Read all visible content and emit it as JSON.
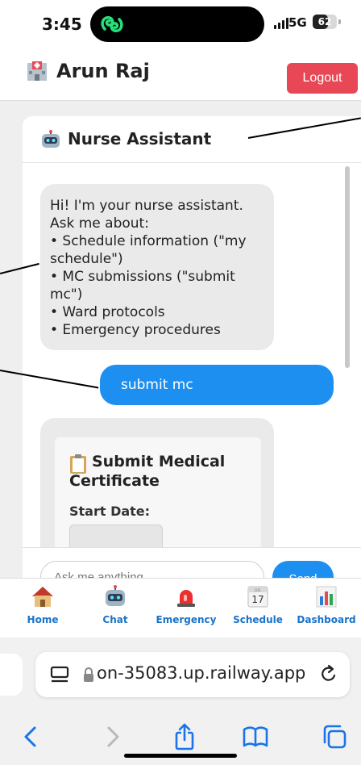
{
  "status_bar": {
    "time": "3:45",
    "network": "5G",
    "battery": "62",
    "battery_level": 0.62
  },
  "header": {
    "username": "Arun Raj",
    "logout_label": "Logout"
  },
  "chat": {
    "title": "Nurse Assistant",
    "bot_message": [
      "Hi! I'm your nurse assistant.",
      "Ask me about:",
      "• Schedule information (\"my",
      "schedule\")",
      "• MC submissions (\"submit",
      "mc\")",
      "• Ward protocols",
      "• Emergency procedures"
    ],
    "user_message": "submit mc",
    "form": {
      "title": "Submit Medical Certificate",
      "start_date_label": "Start Date:"
    },
    "input_placeholder": "Ask me anything...",
    "send_label": "Send"
  },
  "nav": [
    {
      "label": "Home",
      "icon": "home-icon"
    },
    {
      "label": "Chat",
      "icon": "robot-icon"
    },
    {
      "label": "Emergency",
      "icon": "siren-icon"
    },
    {
      "label": "Schedule",
      "icon": "calendar-icon",
      "calendar_day": "17",
      "calendar_month": "JUL"
    },
    {
      "label": "Dashboard",
      "icon": "bar-chart-icon"
    }
  ],
  "browser": {
    "url": "on-35083.up.railway.app"
  },
  "colors": {
    "accent": "#1d8ff0",
    "logout": "#e84855",
    "nav_label": "#1a73c8"
  }
}
